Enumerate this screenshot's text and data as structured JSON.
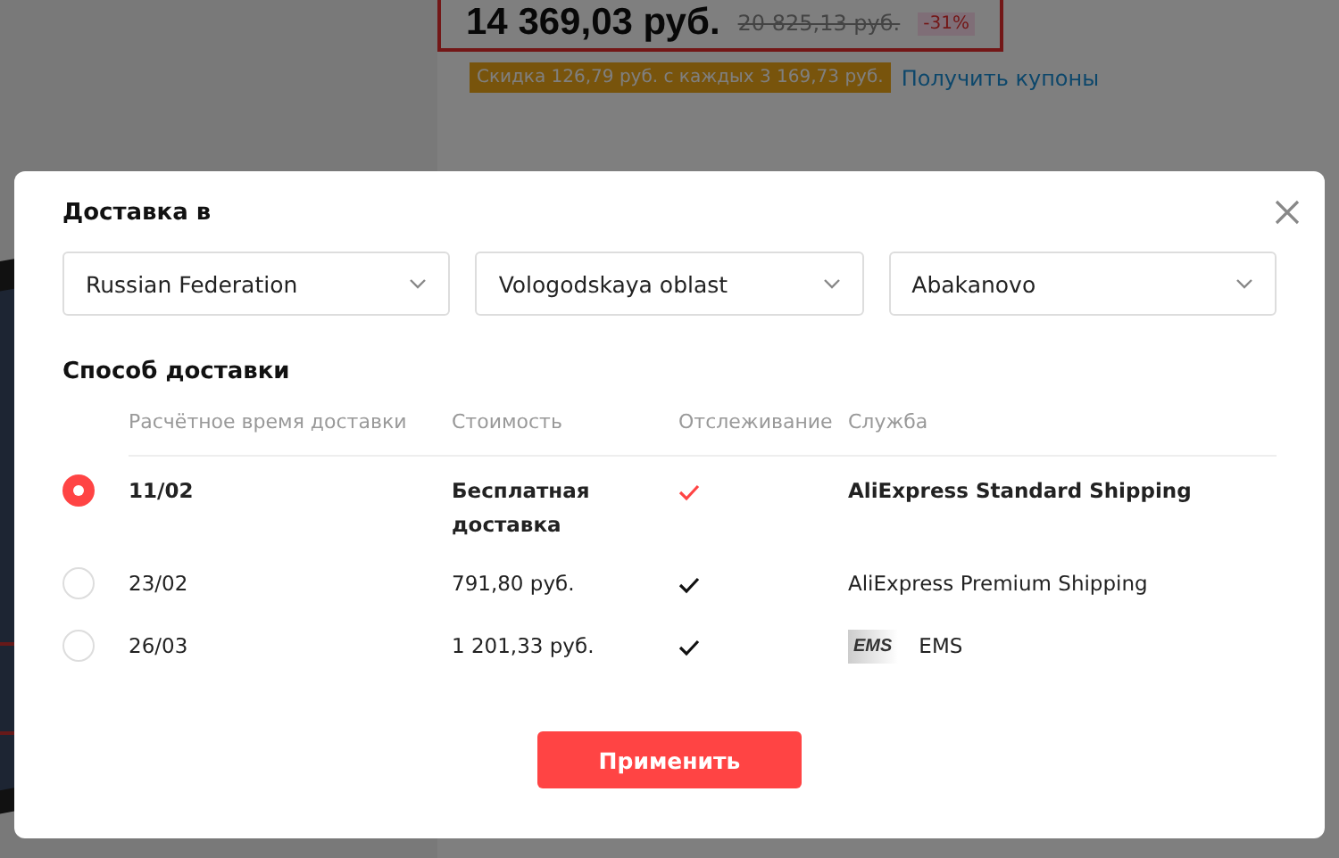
{
  "price": {
    "current": "14 369,03 руб.",
    "old": "20 825,13 руб.",
    "discount": "-31%"
  },
  "coupon": {
    "offer": "Скидка 126,79 руб. с каждых 3 169,73 руб.",
    "link": "Получить купоны"
  },
  "dialog": {
    "title": "Доставка в",
    "selects": [
      {
        "value": "Russian Federation"
      },
      {
        "value": "Vologodskaya oblast"
      },
      {
        "value": "Abakanovo"
      }
    ],
    "section_title": "Способ доставки",
    "columns": [
      "Расчётное время доставки",
      "Стоимость",
      "Отслеживание",
      "Служба"
    ],
    "options": [
      {
        "selected": true,
        "date": "11/02",
        "cost": "Бесплатная доставка",
        "tracking": true,
        "service": "AliExpress Standard Shipping"
      },
      {
        "selected": false,
        "date": "23/02",
        "cost": "791,80 руб.",
        "tracking": true,
        "service": "AliExpress Premium Shipping"
      },
      {
        "selected": false,
        "date": "26/03",
        "cost": "1 201,33 руб.",
        "tracking": true,
        "logo": "EMS",
        "service": "EMS"
      }
    ],
    "apply_button": "Применить"
  }
}
